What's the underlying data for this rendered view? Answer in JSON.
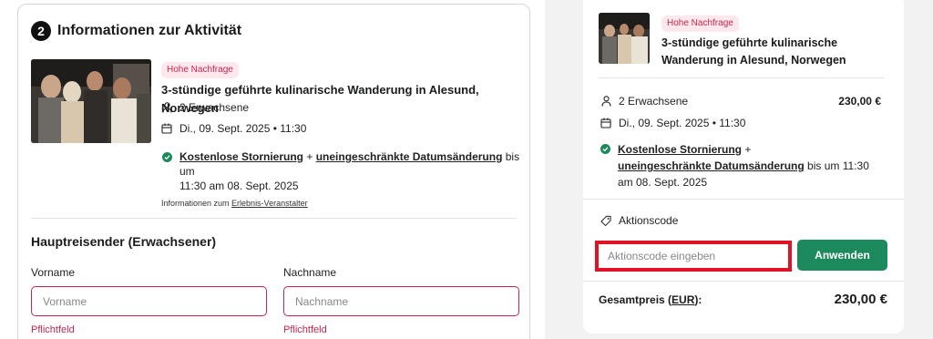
{
  "activity": {
    "step_number": "2",
    "section_title": "Informationen zur Aktivität",
    "badge": "Hohe Nachfrage",
    "title": "3-stündige geführte kulinarische Wanderung in Alesund, Norwegen",
    "travelers": "2 Erwachsene",
    "date": "Di., 09. Sept. 2025 • 11:30",
    "cancellation": {
      "free_cancel": "Kostenlose Stornierung",
      "plus": " + ",
      "unlimited": "uneingeschränkte Datumsänderung",
      "until_line1": " bis um",
      "until_line2": "11:30 am 08. Sept. 2025"
    },
    "operator_prefix": "Informationen zum ",
    "operator_link": "Erlebnis-Veranstalter"
  },
  "traveler_form": {
    "heading": "Hauptreisender (Erwachsener)",
    "first_name_label": "Vorname",
    "first_name_placeholder": "Vorname",
    "last_name_label": "Nachname",
    "last_name_placeholder": "Nachname",
    "required_text": "Pflichtfeld"
  },
  "summary": {
    "badge": "Hohe Nachfrage",
    "title_line1": "3-stündige geführte kulinarische",
    "title_line2": "Wanderung in Alesund, Norwegen",
    "travelers": "2 Erwachsene",
    "travelers_price": "230,00 €",
    "date": "Di., 09. Sept. 2025 • 11:30",
    "free_cancel": "Kostenlose Stornierung",
    "plus": " +",
    "unlimited": "uneingeschränkte Datumsänderung",
    "until_line1": " bis um 11:30",
    "until_line2": "am 08. Sept. 2025",
    "promo_label": "Aktionscode",
    "promo_placeholder": "Aktionscode eingeben",
    "apply_label": "Anwenden",
    "total_prefix": "Gesamtpreis (",
    "total_currency": "EUR",
    "total_suffix": "):",
    "total_value": "230,00 €"
  },
  "colors": {
    "accent_green": "#1d8a5e",
    "error_red": "#c7254e",
    "highlight_red": "#e01324",
    "badge_bg": "#fde8ee"
  }
}
